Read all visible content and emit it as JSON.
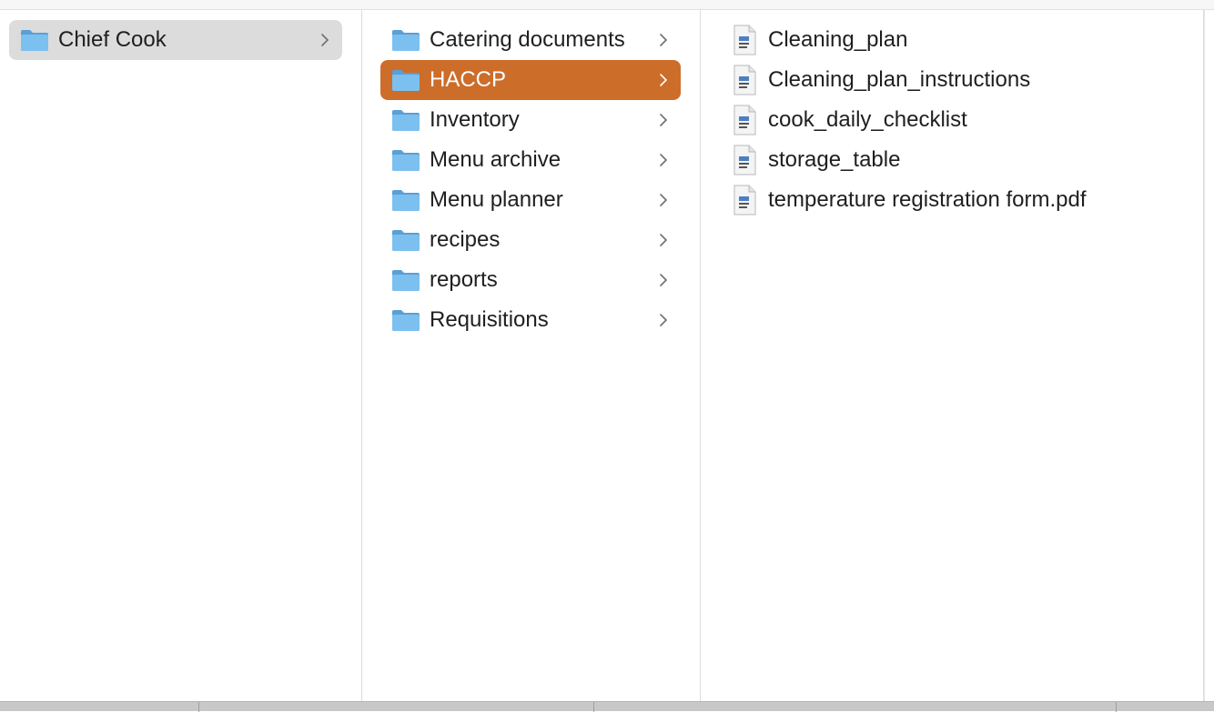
{
  "accent_color": "#cc6d2a",
  "column1": {
    "items": [
      {
        "label": "Chief Cook",
        "icon": "folder-icon",
        "selected": "inactive"
      }
    ]
  },
  "column2": {
    "items": [
      {
        "label": "Catering documents",
        "icon": "folder-icon"
      },
      {
        "label": "HACCP",
        "icon": "folder-icon",
        "selected": "active"
      },
      {
        "label": "Inventory",
        "icon": "folder-icon"
      },
      {
        "label": "Menu archive",
        "icon": "folder-icon"
      },
      {
        "label": "Menu planner",
        "icon": "folder-icon"
      },
      {
        "label": "recipes",
        "icon": "folder-icon"
      },
      {
        "label": "reports",
        "icon": "folder-icon"
      },
      {
        "label": "Requisitions",
        "icon": "folder-icon"
      }
    ]
  },
  "column3": {
    "items": [
      {
        "label": "Cleaning_plan",
        "icon": "document-icon"
      },
      {
        "label": "Cleaning_plan_instructions",
        "icon": "document-icon"
      },
      {
        "label": "cook_daily_checklist",
        "icon": "document-icon"
      },
      {
        "label": "storage_table",
        "icon": "document-icon"
      },
      {
        "label": "temperature registration form.pdf",
        "icon": "document-icon"
      }
    ]
  }
}
